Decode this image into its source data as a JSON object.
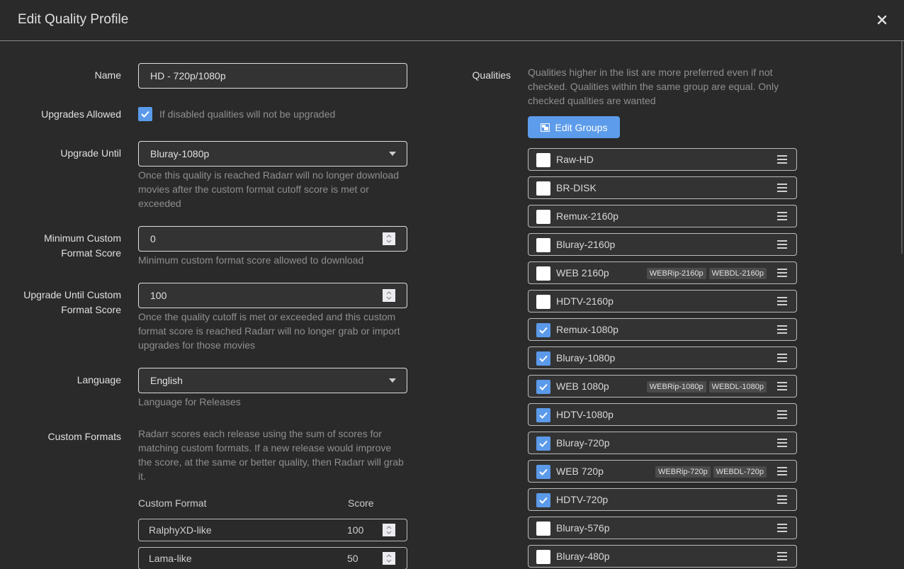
{
  "header": {
    "title": "Edit Quality Profile",
    "close_icon": "close-icon"
  },
  "form": {
    "name": {
      "label": "Name",
      "value": "HD - 720p/1080p"
    },
    "upgrades_allowed": {
      "label": "Upgrades Allowed",
      "checked": true,
      "help": "If disabled qualities will not be upgraded"
    },
    "upgrade_until": {
      "label": "Upgrade Until",
      "value": "Bluray-1080p",
      "help": "Once this quality is reached Radarr will no longer download movies after the custom format cutoff score is met or exceeded"
    },
    "min_cf_score": {
      "label_line1": "Minimum Custom",
      "label_line2": "Format Score",
      "value": "0",
      "help": "Minimum custom format score allowed to download"
    },
    "upgrade_until_cf_score": {
      "label_line1": "Upgrade Until Custom",
      "label_line2": "Format Score",
      "value": "100",
      "help": "Once the quality cutoff is met or exceeded and this custom format score is reached Radarr will no longer grab or import upgrades for those movies"
    },
    "language": {
      "label": "Language",
      "value": "English",
      "help": "Language for Releases"
    },
    "custom_formats": {
      "label": "Custom Formats",
      "help": "Radarr scores each release using the sum of scores for matching custom formats. If a new release would improve the score, at the same or better quality, then Radarr will grab it.",
      "col_format": "Custom Format",
      "col_score": "Score",
      "rows": [
        {
          "name": "RalphyXD-like",
          "score": "100"
        },
        {
          "name": "Lama-like",
          "score": "50"
        }
      ]
    }
  },
  "qualities": {
    "label": "Qualities",
    "help": "Qualities higher in the list are more preferred even if not checked. Qualities within the same group are equal. Only checked qualities are wanted",
    "edit_groups_label": "Edit Groups",
    "items": [
      {
        "name": "Raw-HD",
        "checked": false,
        "tags": []
      },
      {
        "name": "BR-DISK",
        "checked": false,
        "tags": []
      },
      {
        "name": "Remux-2160p",
        "checked": false,
        "tags": []
      },
      {
        "name": "Bluray-2160p",
        "checked": false,
        "tags": []
      },
      {
        "name": "WEB 2160p",
        "checked": false,
        "tags": [
          "WEBRip-2160p",
          "WEBDL-2160p"
        ]
      },
      {
        "name": "HDTV-2160p",
        "checked": false,
        "tags": []
      },
      {
        "name": "Remux-1080p",
        "checked": true,
        "tags": []
      },
      {
        "name": "Bluray-1080p",
        "checked": true,
        "tags": []
      },
      {
        "name": "WEB 1080p",
        "checked": true,
        "tags": [
          "WEBRip-1080p",
          "WEBDL-1080p"
        ]
      },
      {
        "name": "HDTV-1080p",
        "checked": true,
        "tags": []
      },
      {
        "name": "Bluray-720p",
        "checked": true,
        "tags": []
      },
      {
        "name": "WEB 720p",
        "checked": true,
        "tags": [
          "WEBRip-720p",
          "WEBDL-720p"
        ]
      },
      {
        "name": "HDTV-720p",
        "checked": true,
        "tags": []
      },
      {
        "name": "Bluray-576p",
        "checked": false,
        "tags": []
      },
      {
        "name": "Bluray-480p",
        "checked": false,
        "tags": []
      }
    ]
  },
  "colors": {
    "accent": "#5d9ceb",
    "background": "#2a2a2a",
    "input_bg": "#333333"
  }
}
